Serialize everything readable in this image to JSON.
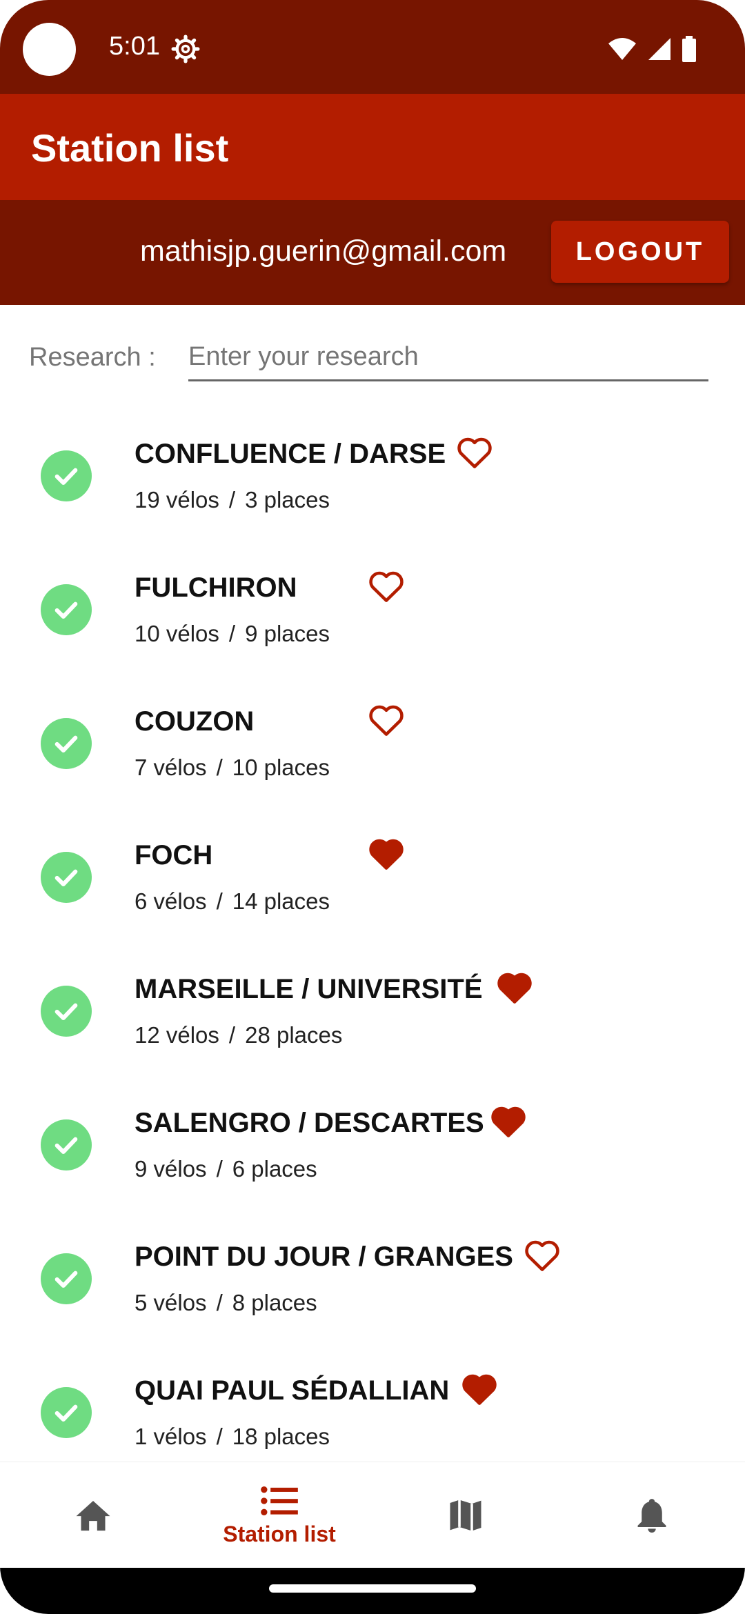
{
  "status_bar": {
    "time": "5:01",
    "icons": [
      "settings-icon",
      "wifi-icon",
      "signal-icon",
      "battery-icon"
    ]
  },
  "app_bar": {
    "title": "Station list"
  },
  "user_row": {
    "email": "mathisjp.guerin@gmail.com",
    "logout_label": "LOGOUT"
  },
  "search": {
    "label": "Research :",
    "placeholder": "Enter your research",
    "value": ""
  },
  "stations": [
    {
      "name": "CONFLUENCE / DARSE",
      "bikes": "19 vélos",
      "places": "3 places",
      "favorite": false
    },
    {
      "name": "FULCHIRON",
      "bikes": "10 vélos",
      "places": "9 places",
      "favorite": false
    },
    {
      "name": "COUZON",
      "bikes": "7 vélos",
      "places": "10 places",
      "favorite": false
    },
    {
      "name": "FOCH",
      "bikes": "6 vélos",
      "places": "14 places",
      "favorite": true
    },
    {
      "name": "MARSEILLE / UNIVERSITÉ",
      "bikes": "12 vélos",
      "places": "28 places",
      "favorite": true
    },
    {
      "name": "SALENGRO / DESCARTES",
      "bikes": "9 vélos",
      "places": "6 places",
      "favorite": true
    },
    {
      "name": "POINT DU JOUR / GRANGES",
      "bikes": "5 vélos",
      "places": "8 places",
      "favorite": false
    },
    {
      "name": "QUAI PAUL SÉDALLIAN",
      "bikes": "1 vélos",
      "places": "18 places",
      "favorite": true
    }
  ],
  "list_separator": "/",
  "bottom_nav": {
    "items": [
      {
        "icon": "home-icon",
        "label": "",
        "active": false
      },
      {
        "icon": "list-icon",
        "label": "Station list",
        "active": true
      },
      {
        "icon": "map-icon",
        "label": "",
        "active": false
      },
      {
        "icon": "bell-icon",
        "label": "",
        "active": false
      }
    ]
  },
  "colors": {
    "dark_red": "#771500",
    "primary_red": "#b31d00",
    "status_green": "#6fdc82",
    "nav_gray": "#555555"
  }
}
